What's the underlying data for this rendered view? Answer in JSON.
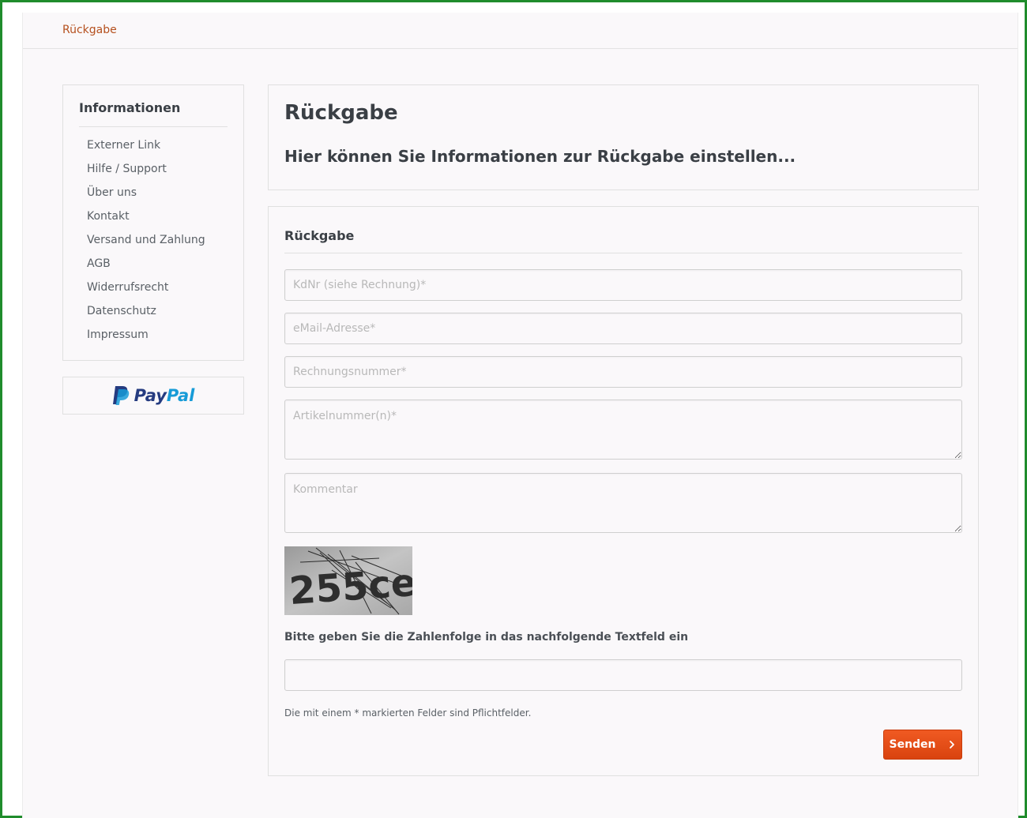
{
  "breadcrumb": {
    "label": "Rückgabe"
  },
  "sidebar": {
    "title": "Informationen",
    "items": [
      {
        "label": "Externer Link"
      },
      {
        "label": "Hilfe / Support"
      },
      {
        "label": "Über uns"
      },
      {
        "label": "Kontakt"
      },
      {
        "label": "Versand und Zahlung"
      },
      {
        "label": "AGB"
      },
      {
        "label": "Widerrufsrecht"
      },
      {
        "label": "Datenschutz"
      },
      {
        "label": "Impressum"
      }
    ],
    "paypal": {
      "pay": "Pay",
      "pal": "Pal",
      "icon": "paypal-icon"
    }
  },
  "info": {
    "title": "Rückgabe",
    "subtitle": "Hier können Sie Informationen zur Rückgabe einstellen..."
  },
  "form": {
    "title": "Rückgabe",
    "fields": {
      "customer_number": {
        "placeholder": "KdNr (siehe Rechnung)*",
        "value": ""
      },
      "email": {
        "placeholder": "eMail-Adresse*",
        "value": ""
      },
      "invoice_number": {
        "placeholder": "Rechnungsnummer*",
        "value": ""
      },
      "article_numbers": {
        "placeholder": "Artikelnummer(n)*",
        "value": ""
      },
      "comment": {
        "placeholder": "Kommentar",
        "value": ""
      },
      "captcha_input": {
        "placeholder": "",
        "value": ""
      }
    },
    "captcha": {
      "text": "255ce"
    },
    "captcha_label": "Bitte geben Sie die Zahlenfolge in das nachfolgende Textfeld ein",
    "required_note": "Die mit einem * markierten Felder sind Pflichtfelder.",
    "send_label": "Senden"
  },
  "colors": {
    "frame": "#1f8c2c",
    "accent": "#d9430f",
    "breadcrumb": "#b5501e",
    "paypal_dark": "#253b80",
    "paypal_light": "#179bd7"
  }
}
